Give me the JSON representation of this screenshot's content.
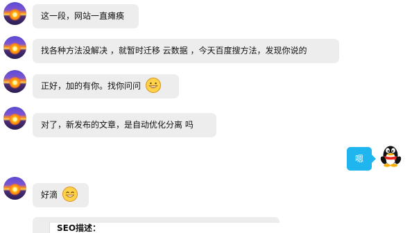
{
  "messages": [
    {
      "text": "这一段，网站一直瘫痪"
    },
    {
      "text": "找各种方法没解决 ，就暂时迁移 云数据 ，今天百度搜方法，发现你说的"
    },
    {
      "text": "正好，加的有你。找你问问",
      "emoji": "grinning-emoji"
    },
    {
      "text": "对了，新发布的文章，是自动优化分离  吗"
    },
    {
      "text": "嗯",
      "sender": "me",
      "color": "#1fb6ef"
    },
    {
      "text": "好滴",
      "emoji": "smiling-emoji"
    }
  ],
  "card": {
    "title": "SEO描述："
  },
  "colors": {
    "incoming_bubble": "#ededed",
    "outgoing_bubble": "#1fb6ef",
    "background": "#ffffff"
  },
  "icons": {
    "left_avatar": "sunset-avatar-icon",
    "right_avatar": "qq-penguin-avatar-icon"
  }
}
